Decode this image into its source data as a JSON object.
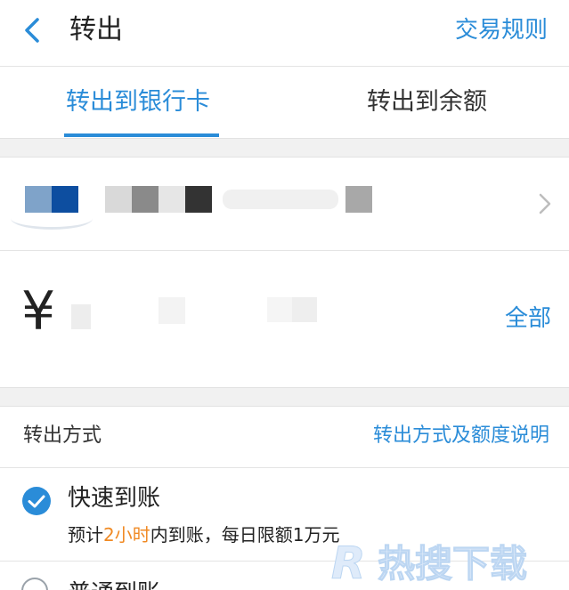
{
  "header": {
    "back_icon": "chevron-left-icon",
    "title": "转出",
    "rules_link": "交易规则"
  },
  "tabs": [
    {
      "label": "转出到银行卡",
      "active": true
    },
    {
      "label": "转出到余额",
      "active": false
    }
  ],
  "bank_card": {
    "masked": true,
    "chevron_icon": "chevron-right-icon"
  },
  "amount": {
    "currency_symbol": "¥",
    "input_value": "",
    "all_button": "全部"
  },
  "method": {
    "title": "转出方式",
    "info_link": "转出方式及额度说明",
    "options": [
      {
        "label": "快速到账",
        "selected": true,
        "desc_prefix": "预计",
        "desc_highlight": "2小时",
        "desc_suffix": "内到账，每日限额1万元"
      },
      {
        "label": "普通到账",
        "selected": false
      }
    ]
  },
  "watermark": {
    "text": "R热搜下载"
  },
  "colors": {
    "accent": "#2a8cd8",
    "highlight": "#f08a24",
    "divider": "#e4e4e4",
    "gap": "#f1f1f1"
  }
}
